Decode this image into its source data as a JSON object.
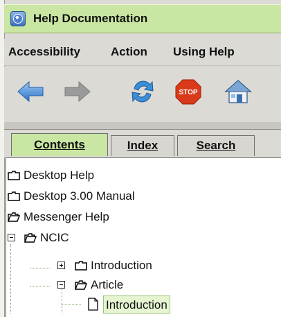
{
  "window": {
    "title": "Help Documentation",
    "icon": "help-icon"
  },
  "menu": [
    "Accessibility",
    "Action",
    "Using Help"
  ],
  "toolbar": {
    "buttons": [
      "back-arrow-icon",
      "forward-arrow-icon",
      "refresh-icon",
      "stop-icon",
      "home-icon"
    ],
    "stop_label": "STOP"
  },
  "tabs": [
    {
      "label": "Contents",
      "active": true
    },
    {
      "label": "Index",
      "active": false
    },
    {
      "label": "Search",
      "active": false
    }
  ],
  "tree": {
    "items": [
      {
        "label": "Desktop Help"
      },
      {
        "label": "Desktop 3.00 Manual"
      },
      {
        "label": "Messenger Help"
      },
      {
        "label": "NCIC"
      },
      {
        "label": "Introduction"
      },
      {
        "label": "Article"
      },
      {
        "label": "Introduction"
      }
    ]
  },
  "colors": {
    "title_bar": "#c9e6a2",
    "selected_tab": "#c9e6a2",
    "selection": "#e5f5d2"
  }
}
